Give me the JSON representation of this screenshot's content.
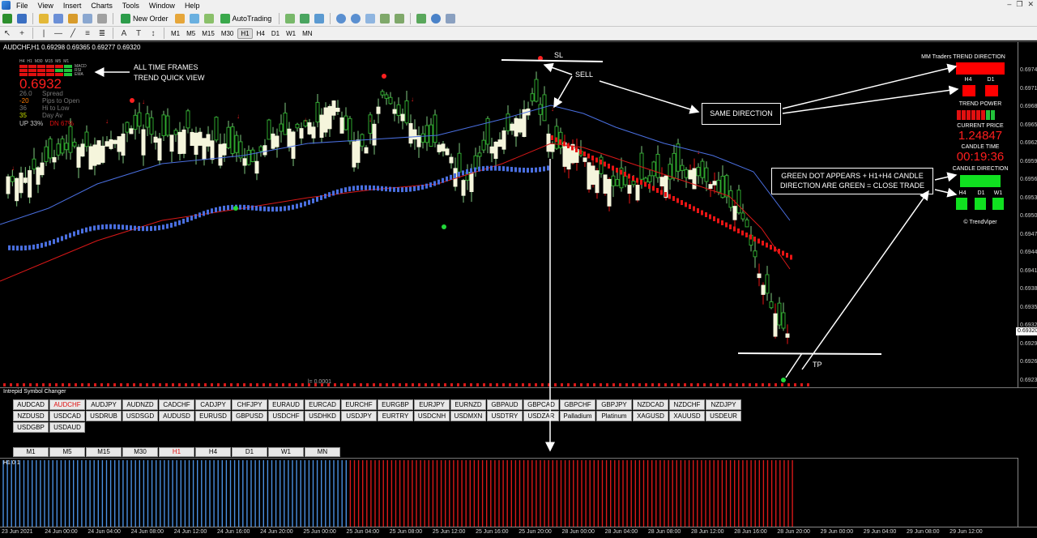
{
  "menu": [
    "File",
    "View",
    "Insert",
    "Charts",
    "Tools",
    "Window",
    "Help"
  ],
  "toolbar": {
    "new_order": "New Order",
    "autotrading": "AutoTrading",
    "timeframes": [
      "M1",
      "M5",
      "M15",
      "M30",
      "H1",
      "H4",
      "D1",
      "W1",
      "MN"
    ]
  },
  "chart": {
    "title": "AUDCHF,H1  0.69298 0.69365 0.69277 0.69320",
    "price_ticks": [
      "0.69745",
      "0.69715",
      "0.69685",
      "0.69655",
      "0.69625",
      "0.69595",
      "0.69565",
      "0.69535",
      "0.69505",
      "0.69475",
      "0.69445",
      "0.69415",
      "0.69385",
      "0.69355",
      "0.69325",
      "0.69295",
      "0.69265",
      "0.69235"
    ],
    "current_price": "0.69320",
    "bottom_label": "l= 0.0001"
  },
  "mtf": {
    "headers": [
      "H4",
      "H1",
      "M30",
      "M15",
      "M5",
      "M1"
    ],
    "labels": [
      "MACD",
      "RSI",
      "EMA"
    ],
    "price": "0.6932",
    "rows": [
      {
        "value": "26.0",
        "label": "Spread",
        "color": "#777777"
      },
      {
        "value": "-20",
        "label": "Pips to Open",
        "color": "#ff7a00"
      },
      {
        "value": "36",
        "label": "Hi to Low",
        "color": "#777777"
      },
      {
        "value": "35",
        "label": "Day Av",
        "color": "#c7e000"
      }
    ],
    "up": "UP 33%",
    "dn": "DN 67%"
  },
  "annotations": {
    "all_tf": "ALL TIME FRAMES",
    "trend_quick": "TREND QUICK VIEW",
    "sl": "SL",
    "sell": "SELL",
    "same_direction": "SAME DIRECTION",
    "green_dot_1": "GREEN DOT APPEARS + H1+H4 CANDLE",
    "green_dot_2": "DIRECTION ARE GREEN = CLOSE TRADE",
    "tp": "TP"
  },
  "right_panel": {
    "trend_direction": "MM Traders TREND DIRECTION",
    "h4": "H4",
    "d1": "D1",
    "trend_power": "TREND POWER",
    "current_price_label": "CURRENT PRICE",
    "current_price": "1.24847",
    "candle_time_label": "CANDLE TIME",
    "candle_time": "00:19:36",
    "candle_direction": "CANDLE DIRECTION",
    "cd_h4": "H4",
    "cd_d1": "D1",
    "cd_w1": "W1",
    "copyright": "© TrendViper",
    "colors": {
      "red": "#ff0000",
      "green": "#10e020"
    }
  },
  "symbol_changer": {
    "title": "Intrepid Symbol Changer",
    "symbols": [
      "AUDCAD",
      "AUDCHF",
      "AUDJPY",
      "AUDNZD",
      "CADCHF",
      "CADJPY",
      "CHFJPY",
      "EURAUD",
      "EURCAD",
      "EURCHF",
      "EURGBP",
      "EURJPY",
      "EURNZD",
      "GBPAUD",
      "GBPCAD",
      "GBPCHF",
      "GBPJPY",
      "NZDCAD",
      "NZDCHF",
      "NZDJPY",
      "NZDUSD",
      "USDCAD",
      "USDRUB",
      "USDSGD",
      "AUDUSD",
      "EURUSD",
      "GBPUSD",
      "USDCHF",
      "USDHKD",
      "USDJPY",
      "EURTRY",
      "USDCNH",
      "USDMXN",
      "USDTRY",
      "USDZAR",
      "Palladium",
      "Platinum",
      "XAGUSD",
      "XAUUSD",
      "USDEUR",
      "USDGBP",
      "USDAUD"
    ],
    "active": "AUDCHF",
    "timeframes": [
      "M1",
      "M5",
      "M15",
      "M30",
      "H1",
      "H4",
      "D1",
      "W1",
      "MN"
    ],
    "active_tf": "H1"
  },
  "histogram": {
    "label": "H1 0 1"
  },
  "time_axis": [
    "23 Jun 2021",
    "24 Jun 00:00",
    "24 Jun 04:00",
    "24 Jun 08:00",
    "24 Jun 12:00",
    "24 Jun 16:00",
    "24 Jun 20:00",
    "25 Jun 00:00",
    "25 Jun 04:00",
    "25 Jun 08:00",
    "25 Jun 12:00",
    "25 Jun 16:00",
    "25 Jun 20:00",
    "28 Jun 00:00",
    "28 Jun 04:00",
    "28 Jun 08:00",
    "28 Jun 12:00",
    "28 Jun 16:00",
    "28 Jun 20:00",
    "29 Jun 00:00",
    "29 Jun 04:00",
    "29 Jun 08:00",
    "29 Jun 12:00"
  ]
}
